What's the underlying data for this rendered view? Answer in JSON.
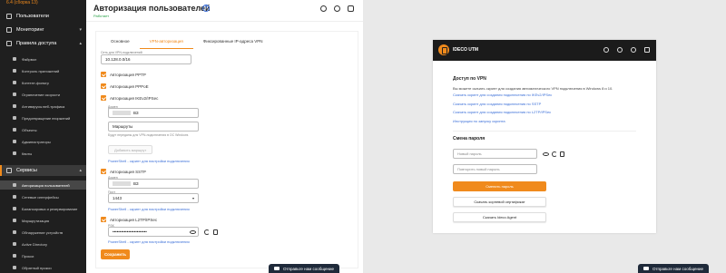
{
  "sidebar": {
    "version": "6.4 (сборка 13)",
    "items": [
      {
        "label": "Пользователи"
      },
      {
        "label": "Мониторинг"
      },
      {
        "label": "Правила доступа"
      }
    ],
    "access_sub": [
      {
        "label": "Файрвол"
      },
      {
        "label": "Контроль приложений"
      },
      {
        "label": "Контент-фильтр"
      },
      {
        "label": "Ограничение скорости"
      },
      {
        "label": "Антивирусы веб-трафика"
      },
      {
        "label": "Предотвращение вторжений"
      },
      {
        "label": "Объекты"
      },
      {
        "label": "Администраторы"
      },
      {
        "label": "Квоты"
      }
    ],
    "services": {
      "label": "Сервисы"
    },
    "services_sub": [
      {
        "label": "Авторизация пользователей"
      },
      {
        "label": "Сетевые интерфейсы"
      },
      {
        "label": "Балансировка и резервирование"
      },
      {
        "label": "Маршрутизация"
      },
      {
        "label": "Обнаружение устройств"
      },
      {
        "label": "Active Directory"
      },
      {
        "label": "Прокси"
      },
      {
        "label": "Обратный прокси"
      }
    ]
  },
  "header": {
    "title": "Авторизация пользователей",
    "subtitle": "Работает"
  },
  "tabs": [
    {
      "label": "Основное"
    },
    {
      "label": "VPN-авторизация"
    },
    {
      "label": "Фиксированные IP-адреса VPN"
    }
  ],
  "form": {
    "vpn_net_label": "Сеть для VPN-подключений",
    "vpn_net_value": "10.128.0.0/16",
    "pptp_label": "Авторизация PPTP",
    "pppoe_label": "Авторизация PPPoE",
    "ikev2_label": "Авторизация IKEv2/IPSec",
    "domain_label": "Домен",
    "domain_value_masked": "ВЗ",
    "routes_value": "Маршруты",
    "routes_hint": "Будут переданы для VPN-подключения в ОС Windows",
    "add_route_label": "Добавить маршрут",
    "ikev2_script_link": "PowerShell - скрипт для настройки подключения",
    "sstp_label": "Авторизация SSTP",
    "sstp_domain_label": "Домен",
    "sstp_domain_value": "ВЗ",
    "port_label": "Порт",
    "port_value": "1443",
    "sstp_script_link": "PowerShell - скрипт для настройки подключения",
    "l2tp_label": "Авторизация L2TP/IPSec",
    "psk_label": "PSK",
    "psk_value": "••••••••••••••••••••••••",
    "l2tp_script_link": "PowerShell - скрипт для настройки подключения",
    "save_label": "Сохранить"
  },
  "chat": {
    "left_label": "Отправьте нам сообщение",
    "right_label": "Отправьте нам сообщение"
  },
  "portal": {
    "brand": "IDECO UTM",
    "vpn_heading": "Доступ по VPN",
    "vpn_text": "Вы можете скачать скрипт для создания автоматического VPN подключения в Windows 8 и 10.",
    "links": [
      "Скачать скрипт для создания подключения по IKEv2/IPSec",
      "Скачать скрипт для создания подключения по SSTP",
      "Скачать скрипт для создания подключения по L2TP/IPSec"
    ],
    "instruction_link": "Инструкция по запуску скрипта",
    "password_heading": "Смена пароля",
    "new_password_placeholder": "Новый пароль",
    "repeat_password_placeholder": "Повторить новый пароль",
    "change_password_label": "Сменить пароль",
    "download_cert_label": "Скачать корневой сертификат",
    "download_agent_label": "Скачать Ideco Agent"
  },
  "colors": {
    "accent": "#f08a1c",
    "sidebar_bg": "#1f1f1f",
    "link": "#3b6fd8",
    "status_ok": "#27a045"
  }
}
